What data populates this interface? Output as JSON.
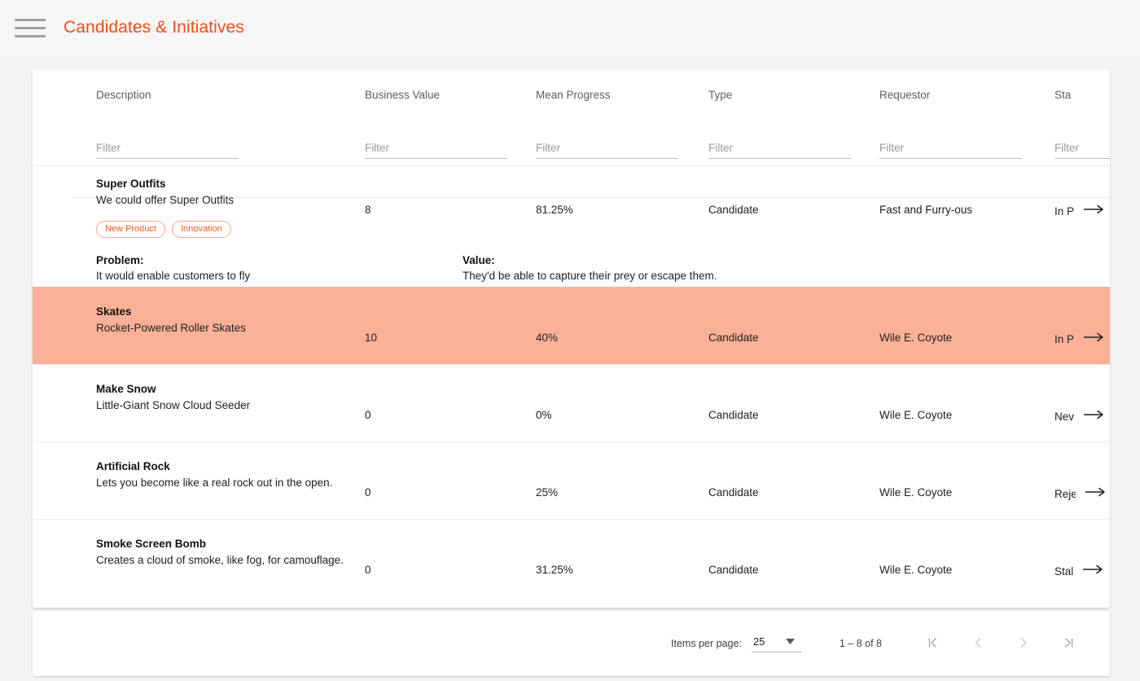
{
  "toolbar": {
    "title": "Candidates & Initiatives",
    "menu_icon": "hamburger-menu-icon"
  },
  "table": {
    "columns": [
      {
        "key": "description",
        "label": "Description"
      },
      {
        "key": "business_value",
        "label": "Business Value"
      },
      {
        "key": "mean_progress",
        "label": "Mean Progress"
      },
      {
        "key": "type",
        "label": "Type"
      },
      {
        "key": "requestor",
        "label": "Requestor"
      },
      {
        "key": "status",
        "label": "Sta"
      }
    ],
    "filters": [
      {
        "key": "description",
        "placeholder": "Filter",
        "value": ""
      },
      {
        "key": "business_value",
        "placeholder": "Filter",
        "value": ""
      },
      {
        "key": "mean_progress",
        "placeholder": "Filter",
        "value": ""
      },
      {
        "key": "type",
        "placeholder": "Filter",
        "value": ""
      },
      {
        "key": "requestor",
        "placeholder": "Filter",
        "value": ""
      },
      {
        "key": "status",
        "placeholder": "Filter",
        "value": ""
      }
    ],
    "rows": [
      {
        "title": "Super Outfits",
        "subtitle": "We could offer Super Outfits",
        "business_value": "8",
        "mean_progress": "81.25%",
        "type": "Candidate",
        "requestor": "Fast and Furry-ous",
        "status": "In P",
        "selected": false,
        "chips": [
          "New Product",
          "Innovation"
        ],
        "detail": {
          "problem_label": "Problem:",
          "problem_text": "It would enable customers to fly",
          "value_label": "Value:",
          "value_text": "They'd be able to capture their prey or escape them."
        }
      },
      {
        "title": "Skates",
        "subtitle": "Rocket-Powered Roller Skates",
        "business_value": "10",
        "mean_progress": "40%",
        "type": "Candidate",
        "requestor": "Wile E. Coyote",
        "status": "In P",
        "selected": true,
        "chips": [],
        "detail": null
      },
      {
        "title": "Make Snow",
        "subtitle": "Little-Giant Snow Cloud Seeder",
        "business_value": "0",
        "mean_progress": "0%",
        "type": "Candidate",
        "requestor": "Wile E. Coyote",
        "status": "Nev",
        "selected": false,
        "chips": [],
        "detail": null
      },
      {
        "title": "Artificial Rock",
        "subtitle": "Lets you become like a real rock out in the open.",
        "business_value": "0",
        "mean_progress": "25%",
        "type": "Candidate",
        "requestor": "Wile E. Coyote",
        "status": "Reje",
        "selected": false,
        "chips": [],
        "detail": null
      },
      {
        "title": "Smoke Screen Bomb",
        "subtitle": "Creates a cloud of smoke, like fog, for camouflage.",
        "business_value": "0",
        "mean_progress": "31.25%",
        "type": "Candidate",
        "requestor": "Wile E. Coyote",
        "status": "Stal",
        "selected": false,
        "chips": [],
        "detail": null
      }
    ]
  },
  "paginator": {
    "items_per_page_label": "Items per page:",
    "items_per_page_value": "25",
    "range_label": "1 – 8 of 8",
    "first_page_icon": "first-page-icon",
    "previous_page_icon": "previous-page-icon",
    "next_page_icon": "next-page-icon",
    "last_page_icon": "last-page-icon"
  },
  "colors": {
    "accent": "#fa4b16",
    "selected_row": "#fbb198",
    "chip_border": "#fba98c",
    "page_background": "#f4f4f4",
    "toolbar_background": "#f7f7f7"
  }
}
